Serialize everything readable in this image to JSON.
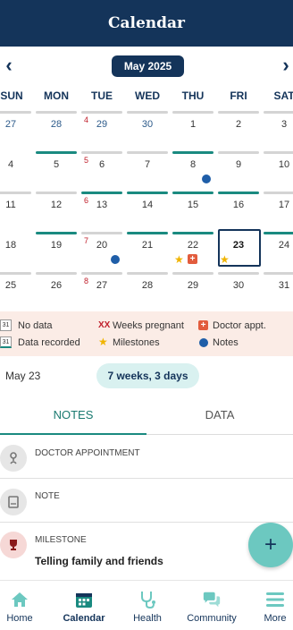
{
  "header": {
    "title": "Calendar"
  },
  "calendar": {
    "month_label": "May 2025",
    "weekdays": [
      "SUN",
      "MON",
      "TUE",
      "WED",
      "THU",
      "FRI",
      "SAT"
    ],
    "week_markers": [
      "4",
      "5",
      "6",
      "7",
      "8"
    ],
    "rows": [
      [
        "27",
        "28",
        "29",
        "30",
        "1",
        "2",
        "3"
      ],
      [
        "4",
        "5",
        "6",
        "7",
        "8",
        "9",
        "10"
      ],
      [
        "11",
        "12",
        "13",
        "14",
        "15",
        "16",
        "17"
      ],
      [
        "18",
        "19",
        "20",
        "21",
        "22",
        "23",
        "24"
      ],
      [
        "25",
        "26",
        "27",
        "28",
        "29",
        "30",
        "31"
      ]
    ],
    "selected_day": "23"
  },
  "legend": {
    "no_data": "No data",
    "no_data_icon_text": "31",
    "data_recorded": "Data recorded",
    "data_recorded_icon_text": "31",
    "weeks_pregnant_symbol": "XX",
    "weeks_pregnant": "Weeks pregnant",
    "milestones": "Milestones",
    "doctor_appt": "Doctor appt.",
    "notes": "Notes"
  },
  "summary": {
    "date": "May 23",
    "pregnancy_length": "7 weeks, 3 days"
  },
  "tabs": {
    "notes": "NOTES",
    "data": "DATA"
  },
  "entries": [
    {
      "label": "DOCTOR APPOINTMENT",
      "title": "",
      "icon": "stethoscope-icon"
    },
    {
      "label": "NOTE",
      "title": "",
      "icon": "note-icon"
    },
    {
      "label": "MILESTONE",
      "title": "Telling family and friends",
      "icon": "trophy-icon"
    }
  ],
  "fab": {
    "symbol": "+"
  },
  "bottom_nav": {
    "items": [
      {
        "label": "Home",
        "icon": "home-icon"
      },
      {
        "label": "Calendar",
        "icon": "calendar-icon",
        "active": true
      },
      {
        "label": "Health",
        "icon": "stethoscope-icon"
      },
      {
        "label": "Community",
        "icon": "chat-icon"
      },
      {
        "label": "More",
        "icon": "menu-icon"
      }
    ]
  },
  "colors": {
    "primary": "#14345a",
    "recorded": "#1a8a80",
    "week_marker": "#c0202c",
    "note_dot": "#1f5ea8",
    "milestone_star": "#f0b400",
    "doctor": "#e25c3d",
    "legend_bg": "#fbece6",
    "pill_bg": "#d9f1f0",
    "fab": "#6cc8c0"
  }
}
